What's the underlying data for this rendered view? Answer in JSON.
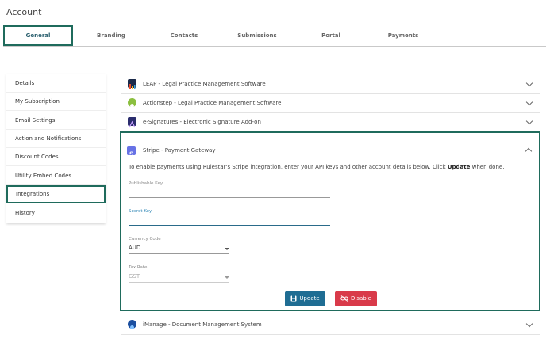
{
  "page": {
    "title": "Account"
  },
  "tabs": [
    {
      "label": "General"
    },
    {
      "label": "Branding"
    },
    {
      "label": "Contacts"
    },
    {
      "label": "Submissions"
    },
    {
      "label": "Portal"
    },
    {
      "label": "Payments"
    }
  ],
  "sidebar": {
    "items": [
      {
        "label": "Details"
      },
      {
        "label": "My Subscription"
      },
      {
        "label": "Email Settings"
      },
      {
        "label": "Action and Notifications"
      },
      {
        "label": "Discount Codes"
      },
      {
        "label": "Utility Embed Codes"
      },
      {
        "label": "Integrations"
      },
      {
        "label": "History"
      }
    ],
    "active_index": 6
  },
  "integrations": {
    "leap": {
      "label": "LEAP - Legal Practice Management Software",
      "icon": "leap-logo-icon"
    },
    "actionstep": {
      "label": "Actionstep - Legal Practice Management Software",
      "icon": "actionstep-logo-icon"
    },
    "esign": {
      "label": "e-Signatures - Electronic Signature Add-on",
      "icon": "esignature-logo-icon"
    },
    "stripe": {
      "label": "Stripe - Payment Gateway",
      "icon": "stripe-logo-icon"
    },
    "imanage": {
      "label": "iManage - Document Management System",
      "icon": "imanage-logo-icon"
    }
  },
  "stripe_panel": {
    "description_pre": "To enable payments using Rulestar's Stripe integration, enter your API keys and other account details below. Click ",
    "description_bold": "Update",
    "description_post": " when done.",
    "publishable_key": {
      "label": "Publishable Key",
      "value": ""
    },
    "secret_key": {
      "label": "Secret Key",
      "value": ""
    },
    "currency_code": {
      "label": "Currency Code",
      "value": "AUD"
    },
    "tax_rate": {
      "label": "Tax Rate",
      "value": "GST"
    },
    "update_label": "Update",
    "disable_label": "Disable"
  },
  "colors": {
    "accent": "#1f6b5c",
    "update_button": "#1f6d93",
    "disable_button": "#d93a4a",
    "stripe": "#6772e5"
  }
}
